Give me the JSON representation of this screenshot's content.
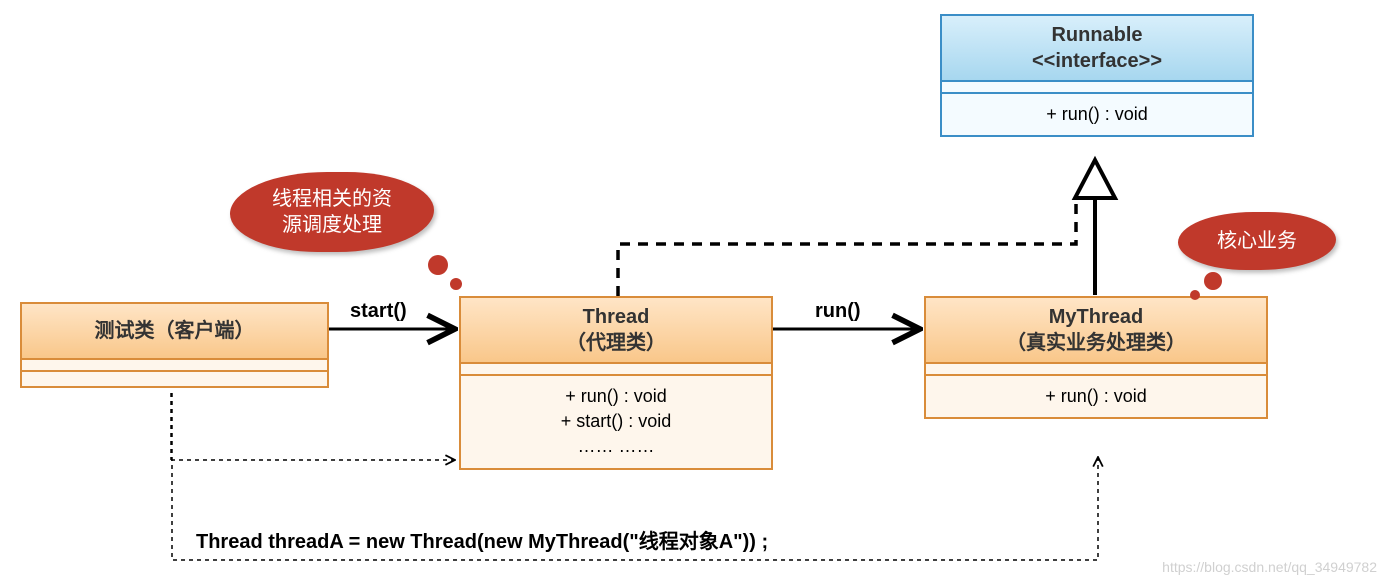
{
  "runnable": {
    "title_line1": "Runnable",
    "title_line2": "<<interface>>",
    "method": "+ run() : void"
  },
  "testClass": {
    "title": "测试类（客户端）"
  },
  "thread": {
    "title_line1": "Thread",
    "title_line2": "（代理类）",
    "method1": "+ run() : void",
    "method2": "+ start() : void",
    "method3": "…… ……"
  },
  "myThread": {
    "title_line1": "MyThread",
    "title_line2": "（真实业务处理类）",
    "method": "+ run() : void"
  },
  "callouts": {
    "threadResource_line1": "线程相关的资",
    "threadResource_line2": "源调度处理",
    "coreBusiness": "核心业务"
  },
  "edges": {
    "start": "start()",
    "run": "run()"
  },
  "codeLine": "Thread threadA = new Thread(new MyThread(\"线程对象A\")) ;",
  "watermark": "https://blog.csdn.net/qq_34949782",
  "colors": {
    "orangeBorder": "#d98c3a",
    "blueBorder": "#3b8ec7",
    "cloud": "#c0392b"
  }
}
